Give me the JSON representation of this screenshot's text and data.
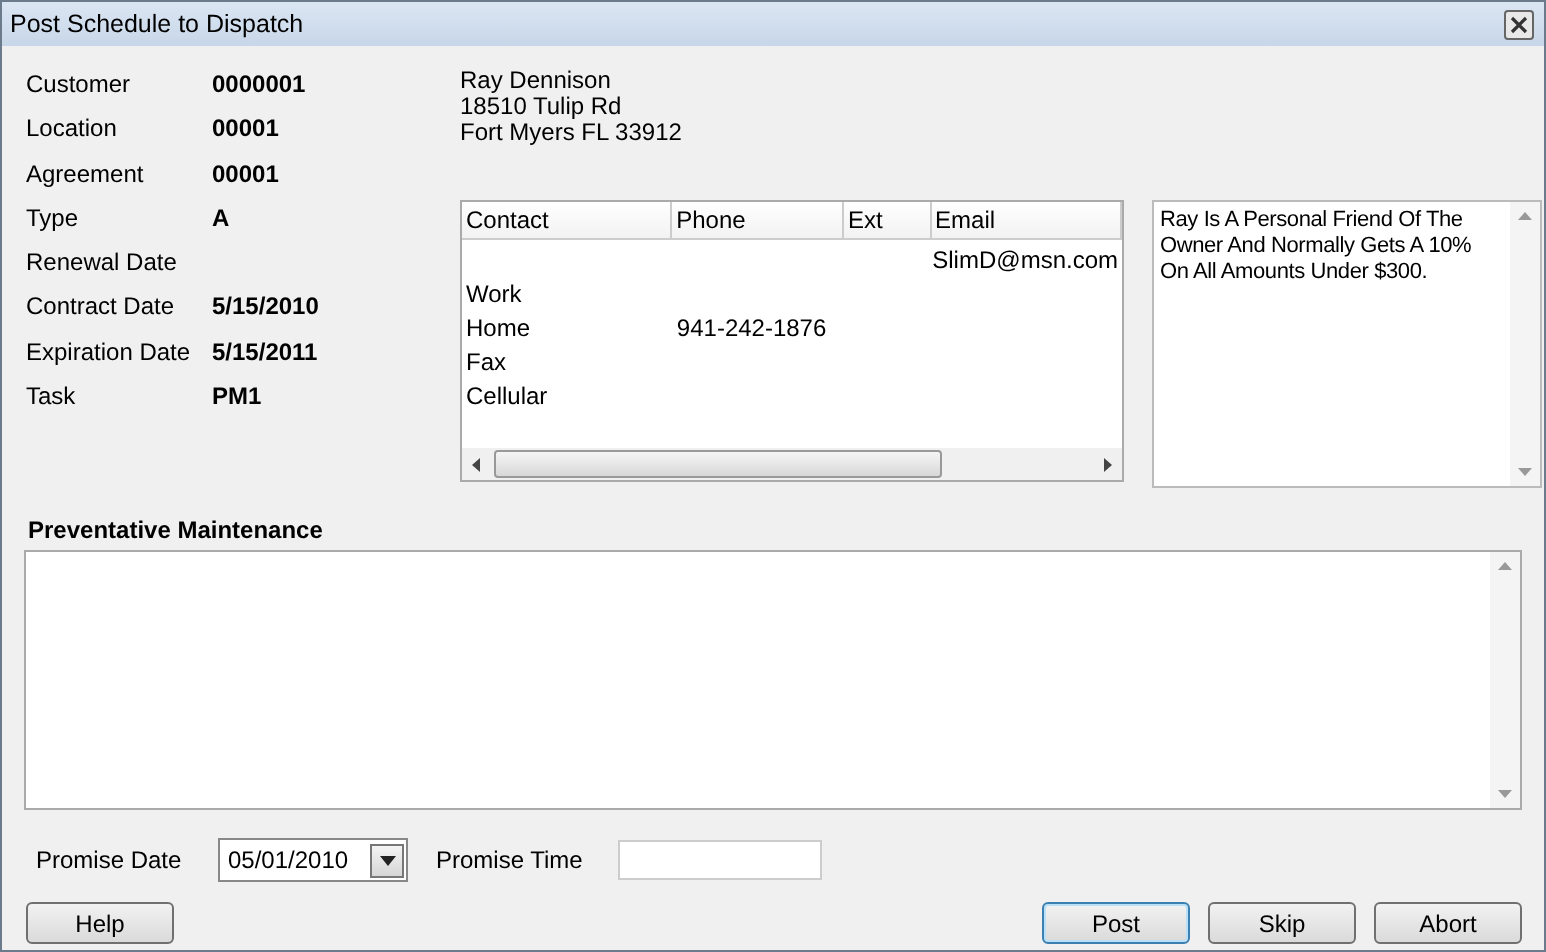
{
  "window": {
    "title": "Post Schedule to Dispatch"
  },
  "fields": [
    {
      "label": "Customer",
      "value": "0000001"
    },
    {
      "label": "Location",
      "value": "00001"
    },
    {
      "label": "Agreement",
      "value": "00001"
    },
    {
      "label": "Type",
      "value": "A"
    },
    {
      "label": "Renewal Date"
    },
    {
      "label": "Contract Date",
      "value": "5/15/2010"
    },
    {
      "label": "Expiration Date",
      "value": "5/15/2011"
    },
    {
      "label": "Task",
      "value": "PM1"
    }
  ],
  "address": [
    "Ray Dennison",
    "18510 Tulip Rd",
    "Fort Myers FL  33912"
  ],
  "contacts": {
    "columns": [
      "Contact",
      "Phone",
      "Ext",
      "Email"
    ],
    "rows": [
      [
        "",
        "",
        "",
        "SlimD@msn.com"
      ],
      [
        "Work",
        "",
        "",
        ""
      ],
      [
        "Home",
        "941-242-1876",
        "",
        ""
      ],
      [
        "Fax",
        "",
        "",
        ""
      ],
      [
        "Cellular",
        "",
        "",
        ""
      ]
    ]
  },
  "notes": "Ray Is A Personal Friend Of The Owner And Normally Gets A 10% On All Amounts Under $300.",
  "maintenance": {
    "label": "Preventative Maintenance"
  },
  "promise_date": {
    "label": "Promise Date",
    "value": "05/01/2010"
  },
  "promise_time": {
    "label": "Promise Time"
  },
  "buttons": [
    {
      "label": "Help",
      "default": false
    },
    {
      "label": "Post",
      "default": true
    },
    {
      "label": "Skip",
      "default": false
    },
    {
      "label": "Abort",
      "default": false
    }
  ]
}
